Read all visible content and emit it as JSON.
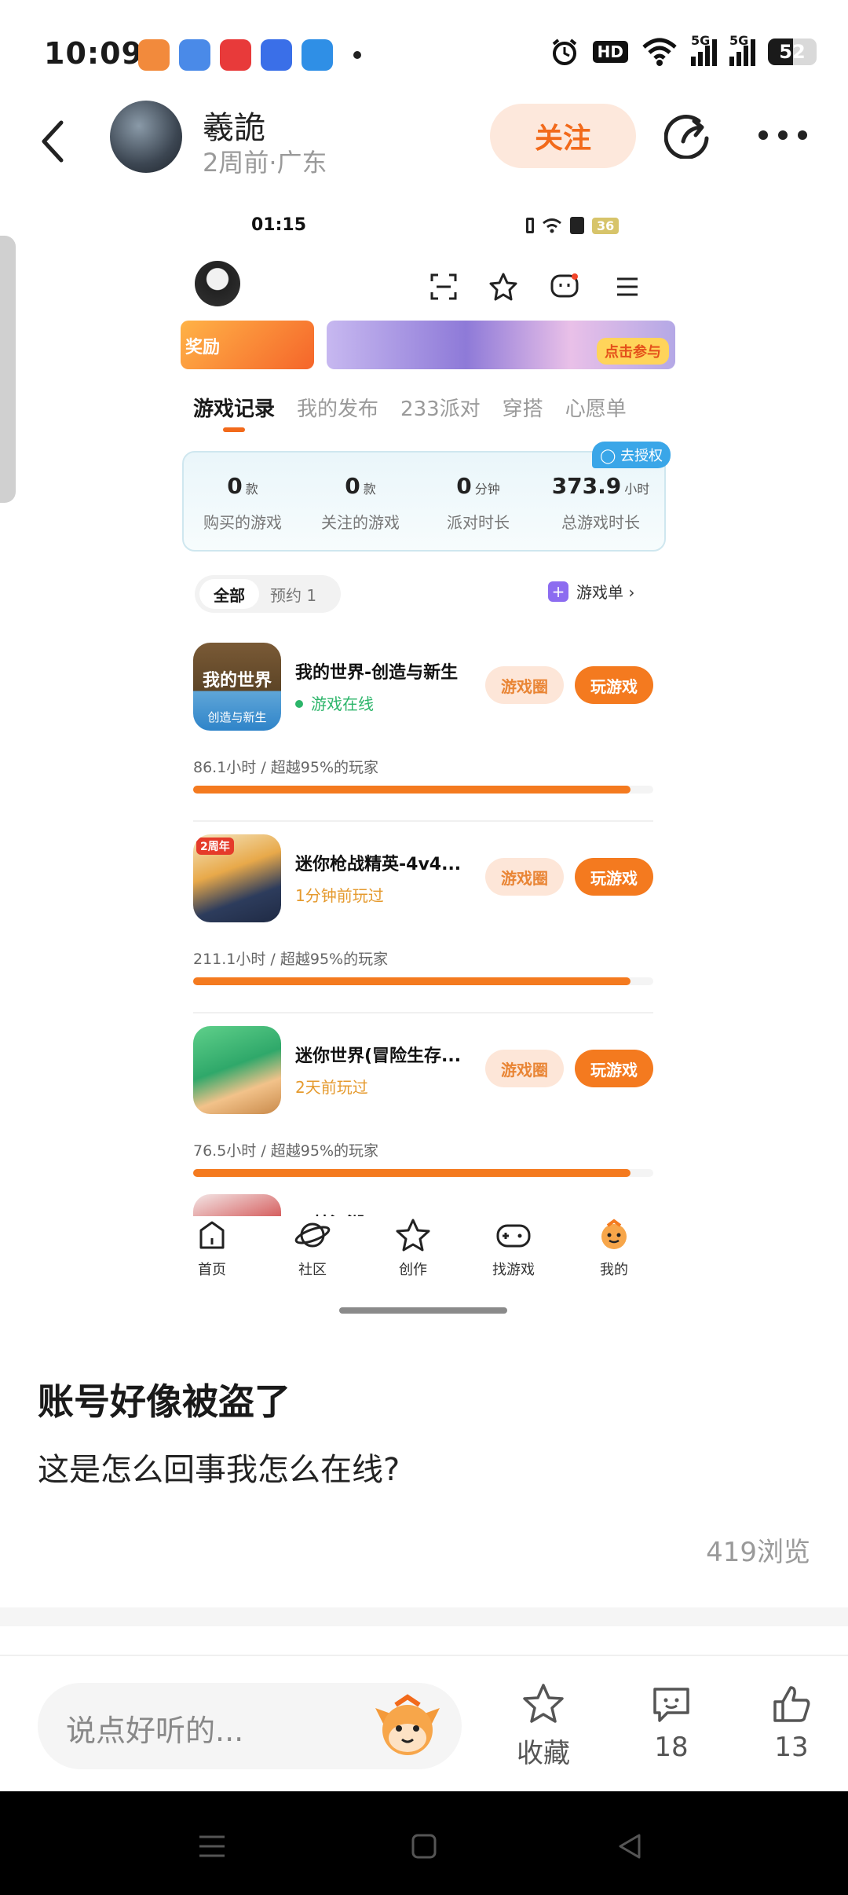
{
  "status_bar": {
    "time": "10:09",
    "battery": "52",
    "hd_label": "HD",
    "signal_labels": [
      "5G",
      "5G"
    ]
  },
  "post_header": {
    "username": "羲詭",
    "meta": "2周前·广东",
    "follow_label": "关注"
  },
  "embedded_screenshot": {
    "status_time": "01:15",
    "status_battery": "36",
    "banner_left_text": "奖励",
    "banner_right_cta": "点击参与",
    "tabs": [
      "游戏记录",
      "我的发布",
      "233派对",
      "穿搭",
      "心愿单"
    ],
    "auth_label": "去授权",
    "stats": [
      {
        "value": "0",
        "unit": "款",
        "label": "购买的游戏"
      },
      {
        "value": "0",
        "unit": "款",
        "label": "关注的游戏"
      },
      {
        "value": "0",
        "unit": "分钟",
        "label": "派对时长"
      },
      {
        "value": "373.9",
        "unit": "小时",
        "label": "总游戏时长"
      }
    ],
    "filter": {
      "all": "全部",
      "reserve": "预约 1"
    },
    "list_link": "游戏单 ›",
    "games": [
      {
        "name": "我的世界-创造与新生",
        "status": "游戏在线",
        "status_type": "online",
        "hours": "86.1小时 / 超越95%的玩家",
        "progress": 0.95,
        "circle_label": "游戏圈",
        "play_label": "玩游戏",
        "icon_text_1": "我的世界",
        "icon_text_2": "创造与新生"
      },
      {
        "name": "迷你枪战精英-4v4...",
        "status": "1分钟前玩过",
        "status_type": "recent",
        "hours": "211.1小时 / 超越95%的玩家",
        "progress": 0.95,
        "circle_label": "游戏圈",
        "play_label": "玩游戏",
        "icon_text_1": "2周年"
      },
      {
        "name": "迷你世界(冒险生存...",
        "status": "2天前玩过",
        "status_type": "recent",
        "hours": "76.5小时 / 超越95%的玩家",
        "progress": 0.95,
        "circle_label": "游戏圈",
        "play_label": "玩游戏"
      },
      {
        "name": "一梦江湖"
      }
    ],
    "nav": [
      {
        "label": "首页",
        "icon": "home-icon"
      },
      {
        "label": "社区",
        "icon": "planet-icon"
      },
      {
        "label": "创作",
        "icon": "star-icon"
      },
      {
        "label": "找游戏",
        "icon": "gamepad-icon"
      },
      {
        "label": "我的",
        "icon": "profile-icon"
      }
    ]
  },
  "post": {
    "title": "账号好像被盗了",
    "body": "这是怎么回事我怎么在线?",
    "views": "419浏览"
  },
  "action_bar": {
    "comment_placeholder": "说点好听的...",
    "favorite_label": "收藏",
    "comment_count": "18",
    "like_count": "13"
  },
  "colors": {
    "accent": "#f26a1b",
    "follow_bg": "#fde8dc",
    "online": "#2cb56a"
  }
}
